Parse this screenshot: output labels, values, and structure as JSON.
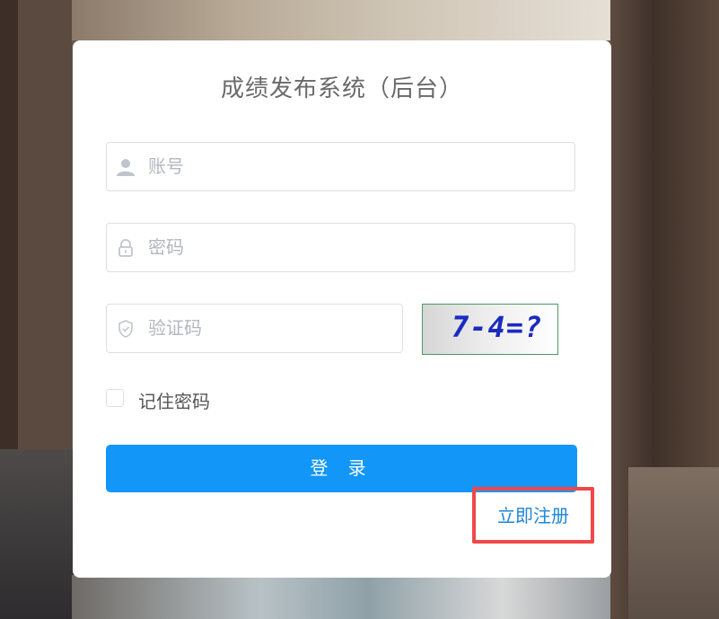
{
  "page": {
    "title": "成绩发布系统（后台）"
  },
  "form": {
    "account_placeholder": "账号",
    "password_placeholder": "密码",
    "captcha_placeholder": "验证码",
    "captcha_image_text": "7-4=?",
    "remember_label": "记住密码",
    "remember_checked": false,
    "login_label": "登 录",
    "register_label": "立即注册"
  },
  "icons": {
    "account": "user-icon",
    "password": "lock-icon",
    "captcha": "shield-check-icon"
  },
  "colors": {
    "primary": "#1296f7",
    "link": "#1e86d6",
    "highlight": "#f04848"
  }
}
